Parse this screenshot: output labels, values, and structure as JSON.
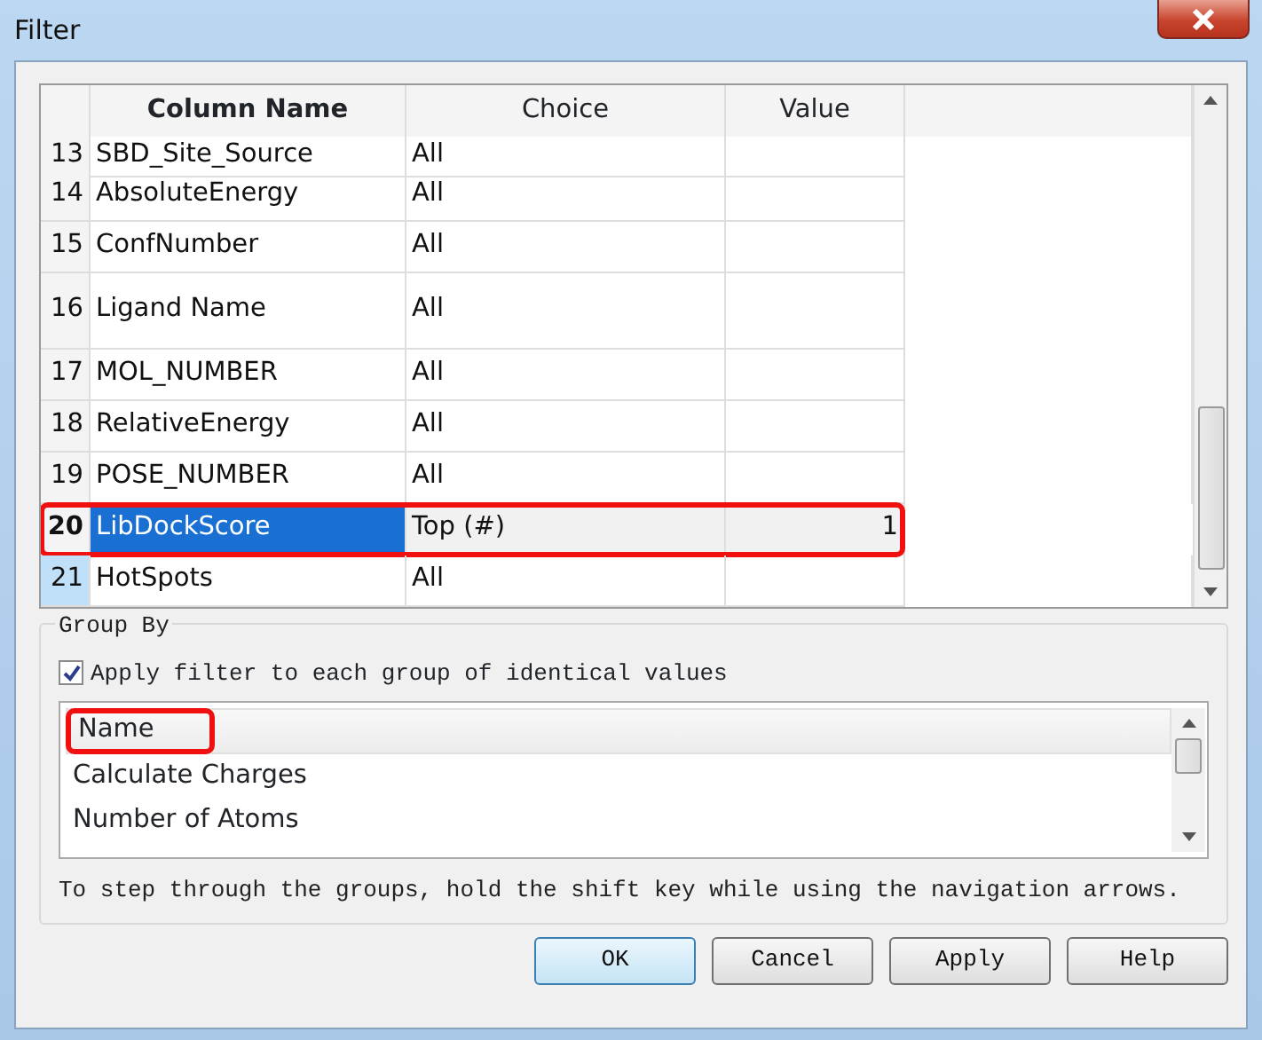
{
  "window": {
    "title": "Filter"
  },
  "table": {
    "columns": [
      "Column Name",
      "Choice",
      "Value"
    ],
    "rows": [
      {
        "number": "13",
        "column_name": "SBD_Site_Source",
        "choice": "All",
        "kind": "partial",
        "selected": false,
        "current": false,
        "highlighted": false
      },
      {
        "number": "14",
        "column_name": "AbsoluteEnergy",
        "choice": "All",
        "kind": "normal",
        "selected": false,
        "current": false,
        "highlighted": false
      },
      {
        "number": "15",
        "column_name": "ConfNumber",
        "choice": "All",
        "kind": "normal",
        "selected": false,
        "current": false,
        "highlighted": false
      },
      {
        "number": "16",
        "column_name": "Ligand Name",
        "choice": "All",
        "kind": "tall",
        "selected": false,
        "current": false,
        "highlighted": false
      },
      {
        "number": "17",
        "column_name": "MOL_NUMBER",
        "choice": "All",
        "kind": "normal",
        "selected": false,
        "current": false,
        "highlighted": false
      },
      {
        "number": "18",
        "column_name": "RelativeEnergy",
        "choice": "All",
        "kind": "normal",
        "selected": false,
        "current": false,
        "highlighted": false
      },
      {
        "number": "19",
        "column_name": "POSE_NUMBER",
        "choice": "All",
        "kind": "normal",
        "selected": false,
        "current": false,
        "highlighted": false
      },
      {
        "number": "20",
        "column_name": "LibDockScore",
        "choice": "Top (#)",
        "value": "1",
        "kind": "normal",
        "selected": true,
        "current": false,
        "highlighted": true
      },
      {
        "number": "21",
        "column_name": "HotSpots",
        "choice": "All",
        "kind": "normal",
        "selected": false,
        "current": true,
        "highlighted": false
      }
    ]
  },
  "group_by": {
    "title": "Group By",
    "checkbox": {
      "label": "Apply filter to each group of identical values",
      "checked": true
    },
    "list": {
      "header": "Name",
      "header_highlighted": true,
      "items": [
        "Calculate Charges",
        "Number of Atoms"
      ]
    },
    "hint": "To step through the groups, hold the shift key while using the navigation arrows."
  },
  "buttons": [
    {
      "label": "OK",
      "default": true
    },
    {
      "label": "Cancel",
      "default": false
    },
    {
      "label": "Apply",
      "default": false
    },
    {
      "label": "Help",
      "default": false
    }
  ]
}
